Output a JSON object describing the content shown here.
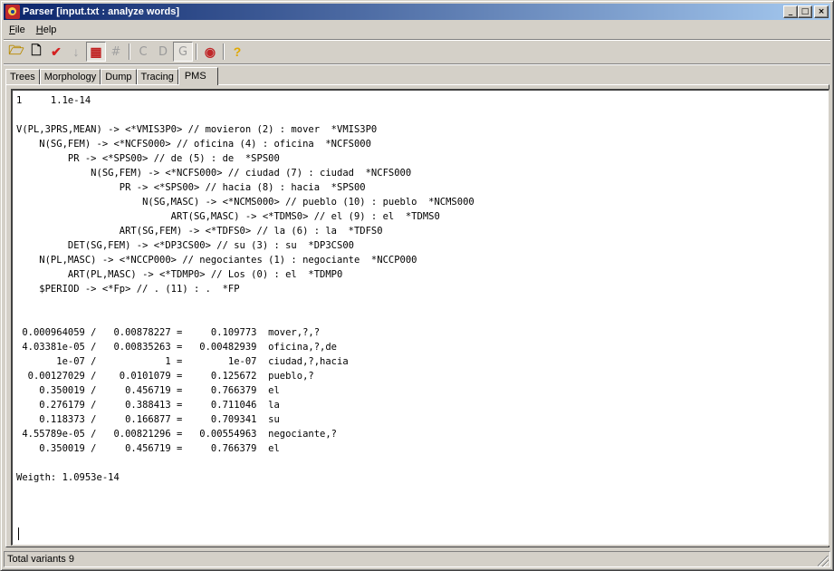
{
  "window": {
    "title": "Parser [input.txt : analyze words]",
    "controls": {
      "minimize": "_",
      "maximize": "□",
      "close": "×"
    }
  },
  "menu": {
    "file": {
      "accel": "F",
      "rest": "ile"
    },
    "help": {
      "accel": "H",
      "rest": "elp"
    }
  },
  "toolbar": {
    "buttons": [
      {
        "icon": "open-folder-icon",
        "glyph": "🗁",
        "color": "#b88a00"
      },
      {
        "icon": "new-document-icon",
        "glyph": "🗋",
        "color": "#000000"
      },
      {
        "icon": "checkmark-icon",
        "glyph": "✔",
        "color": "#d42020"
      },
      {
        "icon": "down-arrow-icon",
        "glyph": "↓",
        "color": "#a0a0a0"
      },
      {
        "icon": "tree-view-icon",
        "glyph": "▦",
        "color": "#c02020"
      },
      {
        "icon": "hash-icon",
        "glyph": "#",
        "color": "#a0a0a0"
      },
      {
        "icon": "letter-c-icon",
        "glyph": "C",
        "color": "#9a9a9a"
      },
      {
        "icon": "letter-d-icon",
        "glyph": "D",
        "color": "#9a9a9a"
      },
      {
        "icon": "letter-g-icon",
        "glyph": "G",
        "color": "#9a9a9a"
      },
      {
        "icon": "parser-app-icon",
        "glyph": "◉",
        "color": "#c0282a"
      },
      {
        "icon": "help-icon",
        "glyph": "?",
        "color": "#e0a800"
      }
    ]
  },
  "tabs": [
    "Trees",
    "Morphology",
    "Dump",
    "Tracing",
    "PMS"
  ],
  "active_tab": "PMS",
  "content": {
    "text": "1     1.1e-14\n\nV(PL,3PRS,MEAN) -> <*VMIS3P0> // movieron (2) : mover  *VMIS3P0\n    N(SG,FEM) -> <*NCFS000> // oficina (4) : oficina  *NCFS000\n         PR -> <*SPS00> // de (5) : de  *SPS00\n             N(SG,FEM) -> <*NCFS000> // ciudad (7) : ciudad  *NCFS000\n                  PR -> <*SPS00> // hacia (8) : hacia  *SPS00\n                      N(SG,MASC) -> <*NCMS000> // pueblo (10) : pueblo  *NCMS000\n                           ART(SG,MASC) -> <*TDMS0> // el (9) : el  *TDMS0\n                  ART(SG,FEM) -> <*TDFS0> // la (6) : la  *TDFS0\n         DET(SG,FEM) -> <*DP3CS00> // su (3) : su  *DP3CS00\n    N(PL,MASC) -> <*NCCP000> // negociantes (1) : negociante  *NCCP000\n         ART(PL,MASC) -> <*TDMP0> // Los (0) : el  *TDMP0\n    $PERIOD -> <*Fp> // . (11) : .  *FP\n\n\n 0.000964059 /   0.00878227 =     0.109773  mover,?,?\n 4.03381e-05 /   0.00835263 =   0.00482939  oficina,?,de\n       1e-07 /            1 =        1e-07  ciudad,?,hacia\n  0.00127029 /    0.0101079 =     0.125672  pueblo,?\n    0.350019 /     0.456719 =     0.766379  el\n    0.276179 /     0.388413 =     0.711046  la\n    0.118373 /     0.166877 =     0.709341  su\n 4.55789e-05 /   0.00821296 =   0.00554963  negociante,?\n    0.350019 /     0.456719 =     0.766379  el\n\nWeigth: 1.0953e-14"
  },
  "status": {
    "text": "Total variants 9"
  }
}
